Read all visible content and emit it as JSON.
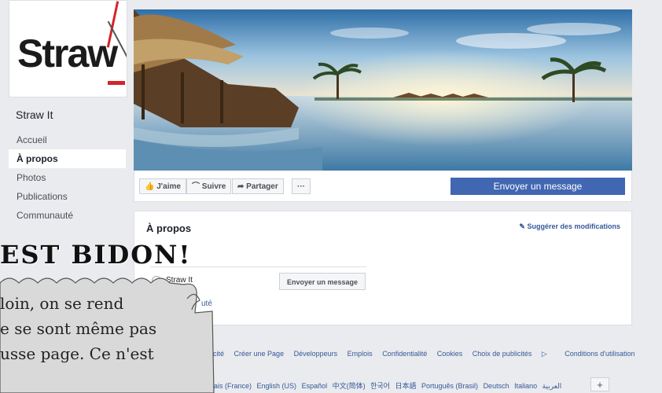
{
  "page": {
    "name": "Straw It",
    "logo_text": "Straw"
  },
  "nav": {
    "items": [
      {
        "label": "Accueil",
        "active": false
      },
      {
        "label": "À propos",
        "active": true
      },
      {
        "label": "Photos",
        "active": false
      },
      {
        "label": "Publications",
        "active": false
      },
      {
        "label": "Communauté",
        "active": false
      }
    ]
  },
  "actions": {
    "like": "J'aime",
    "follow": "Suivre",
    "share": "Partager",
    "more": "···",
    "send_message": "Envoyer un message"
  },
  "about": {
    "title": "À propos",
    "suggest": "Suggérer des modifications",
    "page_name": "Straw It",
    "send_message": "Envoyer un message",
    "community_fragment": "uté"
  },
  "footer": {
    "links": [
      "blicité",
      "Créer une Page",
      "Développeurs",
      "Emplois",
      "Confidentialité",
      "Cookies",
      "Choix de publicités",
      "Conditions d'utilisation"
    ],
    "languages": [
      "ais (France)",
      "English (US)",
      "Español",
      "中文(简体)",
      "한국어",
      "日本語",
      "Português (Brasil)",
      "Deutsch",
      "Italiano",
      "العربية"
    ],
    "plus": "+"
  },
  "overlay": {
    "headline": "EST BIDON!",
    "lines": [
      "loin, on se rend",
      "e se sont même pas",
      "usse page. Ce n'est"
    ]
  },
  "colors": {
    "accent": "#4267b2",
    "link": "#365899",
    "background": "#e9ebee"
  }
}
